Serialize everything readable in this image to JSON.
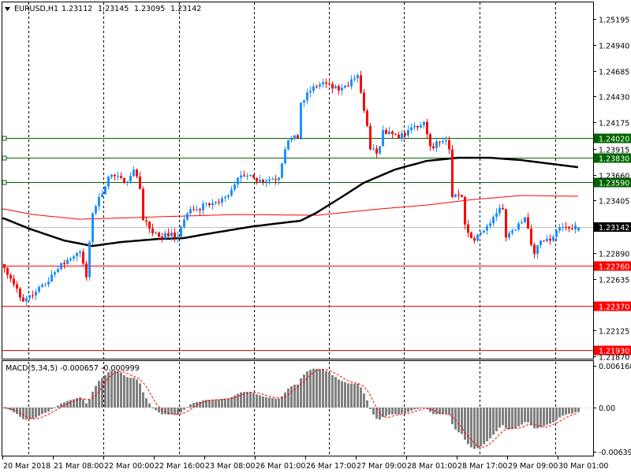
{
  "header": {
    "symbol": "EURUSD,H1",
    "open": "1.23112",
    "high": "1.23145",
    "low": "1.23095",
    "close": "1.23142",
    "menu_icon": "triangle-down-icon"
  },
  "price_axis": {
    "ticks": [
      "1.25195",
      "1.24940",
      "1.24685",
      "1.24430",
      "1.24175",
      "1.23915",
      "1.23660",
      "1.23405",
      "1.22890",
      "1.22635",
      "1.22125",
      "1.21870"
    ],
    "current_price": "1.23142"
  },
  "levels": {
    "green": [
      "1.24020",
      "1.23830",
      "1.23590"
    ],
    "red": [
      "1.22760",
      "1.22370",
      "1.21930"
    ]
  },
  "colors": {
    "bull": "#1E90FF",
    "bear": "#FF0000",
    "support_resistance_green": "#006400",
    "level_red": "#FF0000",
    "ma_slow": "#FF0000",
    "ma_fast": "#000000",
    "macd_hist": "#808080",
    "macd_signal": "#FF0000",
    "current_line": "#C0C0C0"
  },
  "macd": {
    "label": "MACD(5,34,5) -0.000657 -0.000999",
    "axis_max": "0.006168",
    "axis_zero": "0.00",
    "axis_min": "-0.006394"
  },
  "time_axis": [
    "20 Mar 2018",
    "21 Mar 08:00",
    "22 Mar 00:00",
    "22 Mar 16:00",
    "23 Mar 08:00",
    "26 Mar 01:00",
    "26 Mar 17:00",
    "27 Mar 09:00",
    "28 Mar 01:00",
    "28 Mar 17:00",
    "29 Mar 09:00",
    "30 Mar 01:00"
  ],
  "chart_data": {
    "type": "candlestick",
    "symbol": "EURUSD",
    "timeframe": "H1",
    "bars": 183,
    "ylim": [
      1.2187,
      1.25195
    ],
    "close_keypoints": [
      [
        0,
        1.2274
      ],
      [
        3,
        1.2258
      ],
      [
        6,
        1.2241
      ],
      [
        9,
        1.2247
      ],
      [
        13,
        1.2258
      ],
      [
        16,
        1.227
      ],
      [
        20,
        1.2282
      ],
      [
        24,
        1.229
      ],
      [
        26,
        1.2265
      ],
      [
        28,
        1.2328
      ],
      [
        30,
        1.2344
      ],
      [
        34,
        1.2366
      ],
      [
        38,
        1.2358
      ],
      [
        41,
        1.2371
      ],
      [
        43,
        1.2352
      ],
      [
        44,
        1.2321
      ],
      [
        46,
        1.2313
      ],
      [
        49,
        1.2305
      ],
      [
        53,
        1.2309
      ],
      [
        55,
        1.2305
      ],
      [
        58,
        1.2328
      ],
      [
        61,
        1.2332
      ],
      [
        65,
        1.2336
      ],
      [
        70,
        1.2344
      ],
      [
        74,
        1.2363
      ],
      [
        79,
        1.2363
      ],
      [
        81,
        1.2361
      ],
      [
        87,
        1.2363
      ],
      [
        89,
        1.2391
      ],
      [
        90,
        1.24
      ],
      [
        93,
        1.2402
      ],
      [
        94,
        1.2437
      ],
      [
        96,
        1.2447
      ],
      [
        99,
        1.2453
      ],
      [
        101,
        1.2457
      ],
      [
        104,
        1.2451
      ],
      [
        106,
        1.2449
      ],
      [
        109,
        1.2453
      ],
      [
        111,
        1.2461
      ],
      [
        112,
        1.2464
      ],
      [
        114,
        1.2429
      ],
      [
        115,
        1.2414
      ],
      [
        116,
        1.2391
      ],
      [
        118,
        1.2387
      ],
      [
        119,
        1.2394
      ],
      [
        120,
        1.241
      ],
      [
        123,
        1.2406
      ],
      [
        125,
        1.2402
      ],
      [
        128,
        1.241
      ],
      [
        130,
        1.2414
      ],
      [
        133,
        1.2418
      ],
      [
        134,
        1.2406
      ],
      [
        135,
        1.2394
      ],
      [
        138,
        1.2398
      ],
      [
        140,
        1.24
      ],
      [
        141,
        1.2391
      ],
      [
        142,
        1.2344
      ],
      [
        144,
        1.2346
      ],
      [
        145,
        1.2344
      ],
      [
        146,
        1.2317
      ],
      [
        147,
        1.2309
      ],
      [
        149,
        1.2301
      ],
      [
        150,
        1.2307
      ],
      [
        152,
        1.2311
      ],
      [
        154,
        1.2318
      ],
      [
        156,
        1.2328
      ],
      [
        158,
        1.2332
      ],
      [
        159,
        1.2304
      ],
      [
        161,
        1.2311
      ],
      [
        163,
        1.2318
      ],
      [
        165,
        1.2324
      ],
      [
        167,
        1.2297
      ],
      [
        168,
        1.2288
      ],
      [
        170,
        1.2301
      ],
      [
        173,
        1.2301
      ],
      [
        175,
        1.2311
      ],
      [
        179,
        1.2313
      ],
      [
        182,
        1.23142
      ]
    ],
    "last_bar": {
      "open": 1.23112,
      "high": 1.23145,
      "low": 1.23095,
      "close": 1.23142
    },
    "ma_fast_keypoints": [
      [
        0,
        1.23229
      ],
      [
        8,
        1.23128
      ],
      [
        19,
        1.23012
      ],
      [
        28,
        1.22957
      ],
      [
        37,
        1.22996
      ],
      [
        49,
        1.23027
      ],
      [
        57,
        1.23035
      ],
      [
        64,
        1.23074
      ],
      [
        79,
        1.23151
      ],
      [
        94,
        1.23206
      ],
      [
        99,
        1.23284
      ],
      [
        107,
        1.23439
      ],
      [
        114,
        1.23579
      ],
      [
        124,
        1.23711
      ],
      [
        134,
        1.23796
      ],
      [
        144,
        1.23827
      ],
      [
        154,
        1.23827
      ],
      [
        164,
        1.23804
      ],
      [
        174,
        1.23765
      ],
      [
        182,
        1.23734
      ]
    ],
    "ma_slow_keypoints": [
      [
        0,
        1.23322
      ],
      [
        9,
        1.23268
      ],
      [
        24,
        1.23221
      ],
      [
        49,
        1.23245
      ],
      [
        74,
        1.23268
      ],
      [
        99,
        1.2326
      ],
      [
        119,
        1.23322
      ],
      [
        134,
        1.23361
      ],
      [
        149,
        1.23416
      ],
      [
        164,
        1.23455
      ],
      [
        182,
        1.23447
      ]
    ],
    "macd_params": [
      5,
      34,
      5
    ],
    "macd_ylim": [
      -0.006394,
      0.006168
    ]
  }
}
